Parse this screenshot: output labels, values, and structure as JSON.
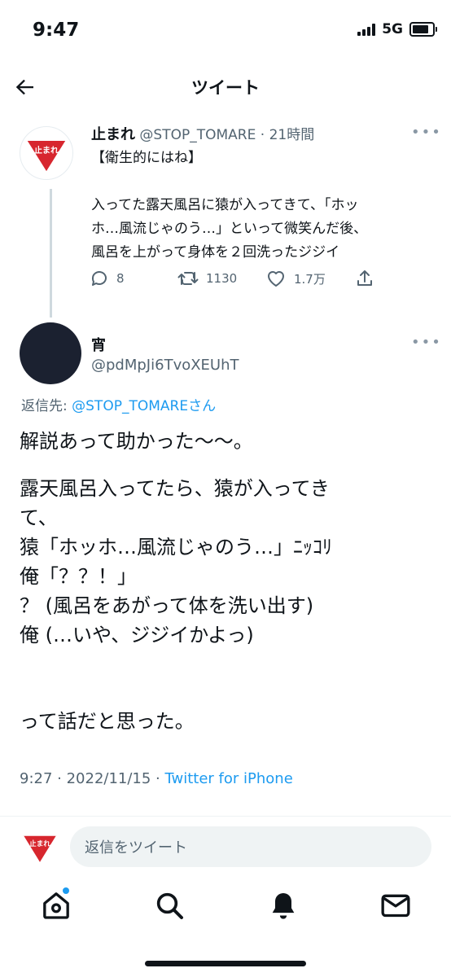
{
  "status_bar": {
    "time": "9:47",
    "network": "5G"
  },
  "header": {
    "title": "ツイート"
  },
  "original_tweet": {
    "avatar_text": "止まれ",
    "name": "止まれ",
    "handle": "@STOP_TOMARE",
    "time_ago": "21時間",
    "text": "【衛生的にはね】\n\n入ってた露天風呂に猿が入ってきて、「ホッ\nホ…風流じゃのう…」といって微笑んだ後、\n風呂を上がって身体を２回洗ったジジイ",
    "replies": "8",
    "retweets": "1130",
    "likes": "1.7万"
  },
  "reply_tweet": {
    "name": "宵",
    "handle": "@pdMpJi6TvoXEUhT",
    "reply_to_prefix": "返信先: ",
    "reply_to_handle": "@STOP_TOMAREさん",
    "text_p1": "解説あって助かった〜〜。",
    "text_p2": "露天風呂入ってたら、猿が入ってき\nて、\n猿「ホッホ…風流じゃのう…」ﾆｯｺﾘ\n俺「？？！」\n？ (風呂をあがって体を洗い出す)\n俺 (…いや、ジジイかよっ)",
    "text_p3": "って話だと思った。",
    "timestamp": "9:27 · 2022/11/15 · ",
    "source": "Twitter for iPhone"
  },
  "reply_bar": {
    "avatar_text": "止まれ",
    "placeholder": "返信をツイート"
  },
  "colors": {
    "accent": "#1d9bf0",
    "stop_sign": "#d7262e",
    "text": "#0f1419",
    "muted": "#536471"
  },
  "bottom_nav": [
    "home-icon",
    "search-icon",
    "notifications-icon",
    "messages-icon"
  ]
}
